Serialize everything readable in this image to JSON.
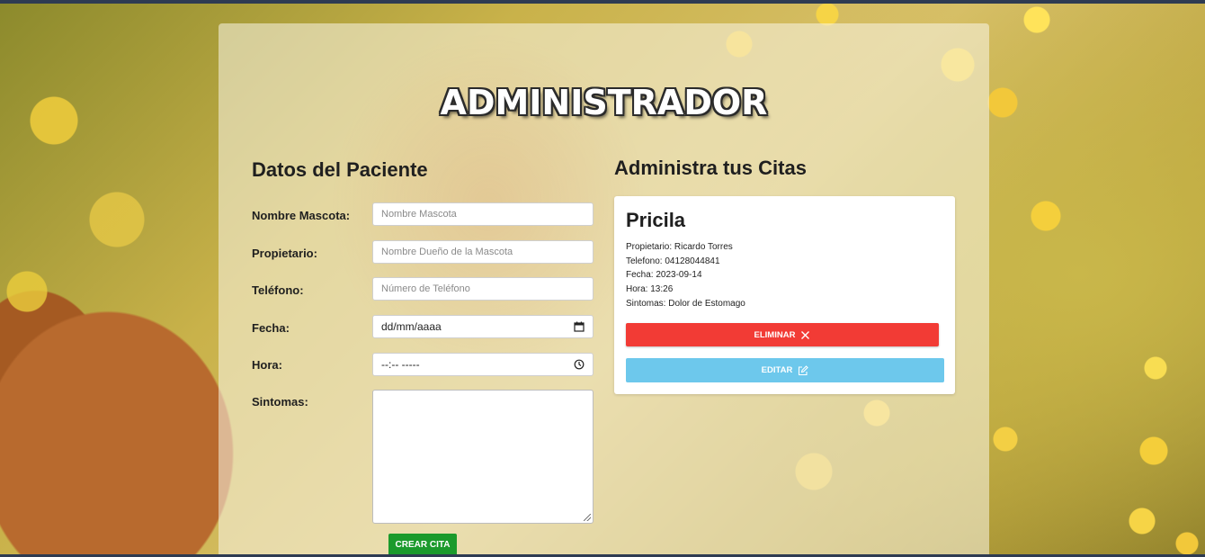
{
  "header": {
    "title": "ADMINISTRADOR"
  },
  "form": {
    "heading": "Datos del Paciente",
    "fields": {
      "pet_name": {
        "label": "Nombre Mascota:",
        "placeholder": "Nombre Mascota"
      },
      "owner": {
        "label": "Propietario:",
        "placeholder": "Nombre Dueño de la Mascota"
      },
      "phone": {
        "label": "Teléfono:",
        "placeholder": "Número de Teléfono"
      },
      "date": {
        "label": "Fecha:",
        "value": "dd/mm/aaaa"
      },
      "time": {
        "label": "Hora:",
        "value": "--:-- -----"
      },
      "symptoms": {
        "label": "Sintomas:"
      }
    },
    "submit_label": "CREAR CITA"
  },
  "appointments": {
    "heading": "Administra tus Citas",
    "items": [
      {
        "pet": "Pricila",
        "owner": "Propietario: Ricardo Torres",
        "phone": "Telefono: 04128044841",
        "date": "Fecha: 2023-09-14",
        "time": "Hora: 13:26",
        "symptoms": "Sintomas: Dolor de Estomago",
        "delete_label": "ELIMINAR",
        "edit_label": "EDITAR"
      }
    ]
  },
  "icons": {
    "calendar": "calendar-icon",
    "clock": "clock-icon",
    "close": "close-icon",
    "edit": "edit-icon"
  },
  "colors": {
    "delete": "#f23b35",
    "edit": "#6dc8ec",
    "create": "#1b9a2c"
  }
}
